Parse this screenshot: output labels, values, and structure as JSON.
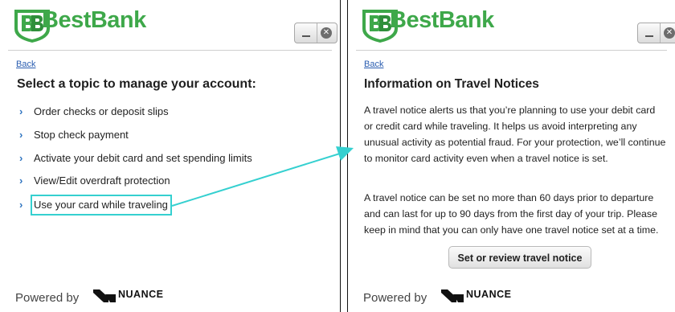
{
  "colors": {
    "brand_green": "#3ea84a",
    "link_blue": "#2a5db0",
    "chevron_blue": "#2f74c0",
    "highlight_cyan": "#35d0d0"
  },
  "left_panel": {
    "brand": "BestBank",
    "back": "Back",
    "title": "Select a topic to manage your account:",
    "topics": [
      "Order checks or deposit slips",
      "Stop check payment",
      "Activate your debit card and set spending limits",
      "View/Edit overdraft protection",
      "Use your card while traveling"
    ],
    "highlighted_topic_index": 4,
    "footer": {
      "powered_by": "Powered by",
      "vendor": "NUANCE"
    }
  },
  "right_panel": {
    "brand": "BestBank",
    "back": "Back",
    "title": "Information on Travel Notices",
    "paragraph1": "A travel notice alerts us that you’re planning to use your debit card or credit card while traveling. It helps us avoid interpreting any unusual activity as potential fraud. For your protection, we’ll continue to monitor card activity even when a travel notice is set.",
    "paragraph2": "A travel notice can be set no more than 60 days prior to departure and can last for up to 90 days from the first day of your trip. Please keep in mind that you can only have one travel notice set at a time.",
    "button": "Set or review travel notice",
    "footer": {
      "powered_by": "Powered by",
      "vendor": "NUANCE"
    }
  },
  "icons": {
    "logo": "bestbank-shield-logo-icon",
    "window_minimize": "minimize-icon",
    "window_close": "close-icon",
    "topic_bullet": "chevron-right-icon",
    "vendor_logo": "nuance-logo-icon",
    "connector": "arrow-icon"
  }
}
